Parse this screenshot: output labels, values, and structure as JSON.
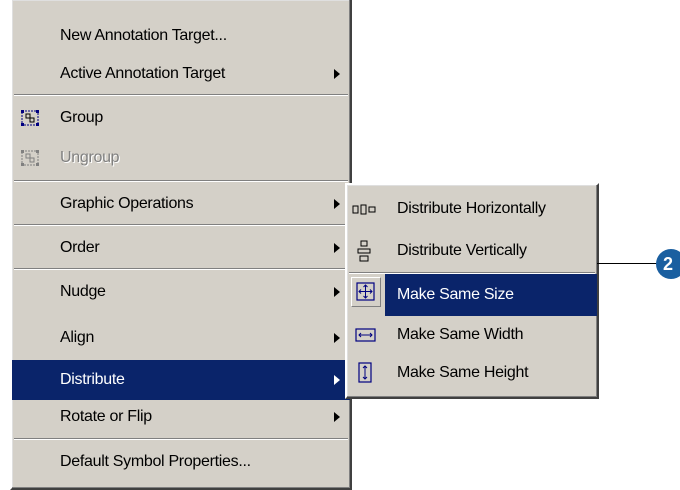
{
  "main_menu": {
    "new_annotation_target": "New Annotation Target...",
    "active_annotation_target": "Active Annotation Target",
    "group": "Group",
    "ungroup": "Ungroup",
    "graphic_operations": "Graphic Operations",
    "order": "Order",
    "nudge": "Nudge",
    "align": "Align",
    "distribute": "Distribute",
    "rotate_or_flip": "Rotate or Flip",
    "default_symbol_properties": "Default Symbol Properties..."
  },
  "sub_menu": {
    "distribute_horizontally": "Distribute Horizontally",
    "distribute_vertically": "Distribute Vertically",
    "make_same_size": "Make Same Size",
    "make_same_width": "Make Same Width",
    "make_same_height": "Make Same Height"
  },
  "callout": {
    "number": "2"
  },
  "colors": {
    "menu_background": "#d4d0c8",
    "highlight": "#0a246a",
    "callout": "#1a5fa0"
  },
  "icons": {
    "group": "group-icon",
    "ungroup": "ungroup-icon",
    "distribute_horizontally": "distribute-horizontally-icon",
    "distribute_vertically": "distribute-vertically-icon",
    "make_same_size": "make-same-size-icon",
    "make_same_width": "make-same-width-icon",
    "make_same_height": "make-same-height-icon"
  }
}
